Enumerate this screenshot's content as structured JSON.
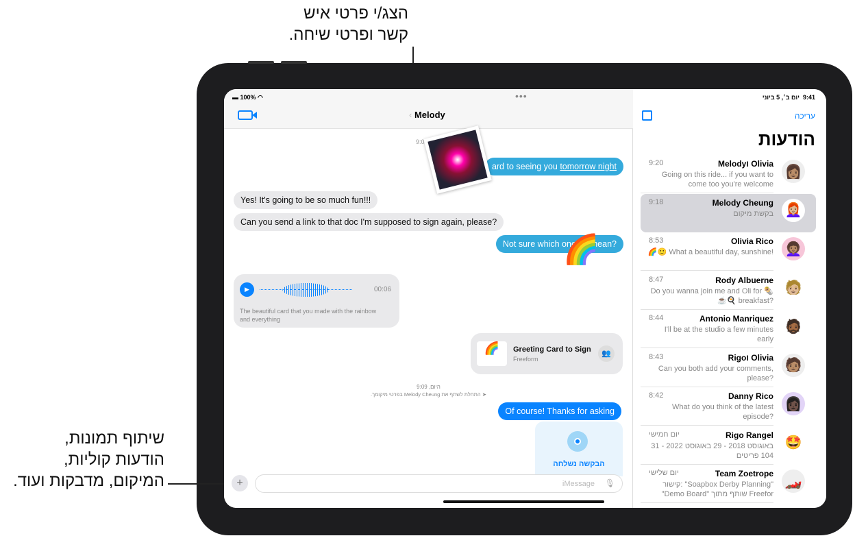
{
  "callouts": {
    "top": [
      "הצג/י פרטי איש",
      "קשר ופרטי שיחה."
    ],
    "bottom": [
      "שיתוף תמונות,",
      "הודעות קוליות,",
      "המיקום, מדבקות ועוד."
    ]
  },
  "status_left": {
    "battery": "100%",
    "time": "9:41",
    "date": "יום ב׳, 5 ביוני"
  },
  "chat": {
    "title": "Melody",
    "timestamp_partial": "9:0",
    "messages": [
      {
        "text_start": "ard to seeing you ",
        "link": "tomorrow night"
      },
      {
        "text": "Yes! It's going to be so much fun!!!"
      },
      {
        "text": "Can you send a link to that doc I'm supposed to sign again, please?"
      },
      {
        "text_a": "Not sure which one",
        "text_b": "mean?"
      },
      {
        "audio_duration": "00:06",
        "transcript": "The beautiful card that you made with the rainbow and everything"
      },
      {
        "card_title": "Greeting Card to Sign",
        "card_subtitle": "Freeform"
      },
      {
        "text": "Of course! Thanks for asking"
      }
    ],
    "system_time": "היום, 9:09",
    "system_note": "התחלת לשתף את Melody Cheung בפרטי מיקומך.",
    "location_request": "הבקשה נשלחה",
    "input_placeholder": "iMessage"
  },
  "sidebar": {
    "edit": "עריכה",
    "title": "הודעות",
    "conversations": [
      {
        "name": "Melodyו Olivia",
        "time": "9:20",
        "preview": "Going on this ride... if you want to come too you're welcome",
        "avatar": "👩🏽"
      },
      {
        "name": "Melody Cheung",
        "time": "9:18",
        "preview": "בקשת מיקום",
        "avatar": "👩🏼‍🦰",
        "selected": true
      },
      {
        "name": "Olivia Rico",
        "time": "8:53",
        "preview": "🌈🙂 What a beautiful day, sunshine!",
        "avatar": "👩🏽‍🦱"
      },
      {
        "name": "Rody Albuerne",
        "time": "8:47",
        "preview": "Do you wanna join me and Oli for 🌯☕🍳 breakfast?",
        "avatar": "🧑🏼"
      },
      {
        "name": "Antonio Manriquez",
        "time": "8:44",
        "preview": "I'll be at the studio a few minutes early",
        "avatar": "🧔🏾"
      },
      {
        "name": "Rigoו Olivia",
        "time": "8:43",
        "preview": "Can you both add your comments, please?",
        "avatar": "🧑🏽"
      },
      {
        "name": "Danny Rico",
        "time": "8:42",
        "preview": "What do you think of the latest episode?",
        "avatar": "👩🏿"
      },
      {
        "name": "Rigo Rangel",
        "time": "יום חמישי",
        "preview": "31 באוגוסט 2018 - 29 באוגוסט 2022 - 104 פריטים",
        "avatar": "🤩"
      },
      {
        "name": "Team Zoetrope",
        "time": "יום שלישי",
        "preview": "קישור: \"Soapbox Derby Planning\" \"Demo Board\" שותף מתוך Freefor",
        "avatar": "🏎️"
      }
    ]
  },
  "colors": {
    "accent": "#0a84ff",
    "bubble_out": "#34aadc",
    "bubble_in": "#e9e9eb"
  }
}
